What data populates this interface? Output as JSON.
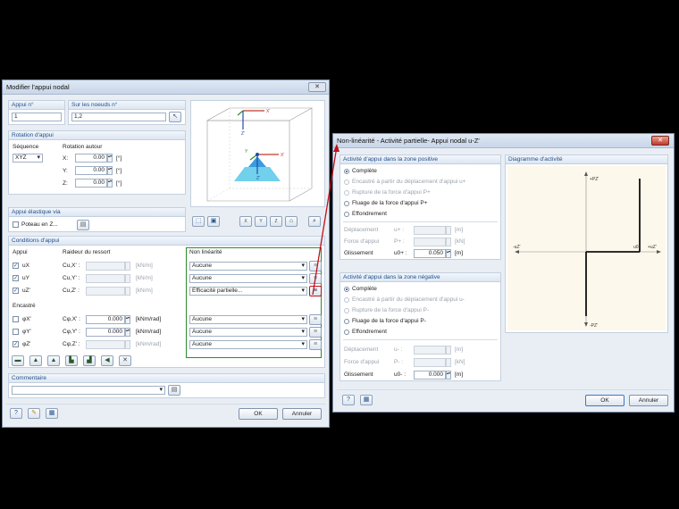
{
  "dialog1": {
    "title": "Modifier l'appui nodal",
    "appui_no_label": "Appui n°",
    "appui_no": "1",
    "noeuds_label": "Sur les noeuds n°",
    "noeuds": "1,2",
    "rotation_header": "Rotation d'appui",
    "sequence_label": "Séquence",
    "sequence_value": "XYZ",
    "rotation_label": "Rotation autour",
    "rot": [
      {
        "axis": "X:",
        "value": "0.00",
        "unit": "[°]"
      },
      {
        "axis": "Y:",
        "value": "0.00",
        "unit": "[°]"
      },
      {
        "axis": "Z:",
        "value": "0.00",
        "unit": "[°]"
      }
    ],
    "elastic_header": "Appui élastique via",
    "poteau_label": "Poteau en Z...",
    "conditions_header": "Conditions d'appui",
    "appui_col": "Appui",
    "raideur_col": "Raideur du ressort",
    "nonlin_col": "Non linéarité",
    "trans_rows": [
      {
        "name": "uX",
        "checked": true,
        "coef": "Cu,X' :",
        "unit": "[kN/m]",
        "nonlin": "Aucune"
      },
      {
        "name": "uY",
        "checked": true,
        "coef": "Cu,Y' :",
        "unit": "[kN/m]",
        "nonlin": "Aucune"
      },
      {
        "name": "uZ'",
        "checked": true,
        "coef": "Cu,Z' :",
        "unit": "[kN/m]",
        "nonlin": "Efficacité partielle..."
      }
    ],
    "encastre_label": "Encastré",
    "rot_rows": [
      {
        "name": "φX'",
        "checked": false,
        "coef": "Cφ,X' :",
        "value": "0.000",
        "unit": "[kNm/rad]",
        "nonlin": "Aucune"
      },
      {
        "name": "φY'",
        "checked": false,
        "coef": "Cφ,Y' :",
        "value": "0.000",
        "unit": "[kNm/rad]",
        "nonlin": "Aucune"
      },
      {
        "name": "φZ'",
        "checked": true,
        "coef": "Cφ,Z' :",
        "value": "",
        "unit": "[kNm/rad]",
        "nonlin": "Aucune"
      }
    ],
    "commentaire_header": "Commentaire",
    "ok": "OK",
    "annuler": "Annuler",
    "axis_x": "X'",
    "axis_y": "Y",
    "axis_z": "Z'"
  },
  "dialog2": {
    "title": "Non-linéarité - Activité partielle- Appui nodal u-Z'",
    "pos_header": "Activité d'appui dans la zone positive",
    "pos_options": [
      {
        "label": "Complète",
        "selected": true,
        "enabled": true
      },
      {
        "label": "Encastré à partir du déplacement d'appui u+",
        "selected": false,
        "enabled": false
      },
      {
        "label": "Rupture de la force d'appui P+",
        "selected": false,
        "enabled": false
      },
      {
        "label": "Fluage de la force d'appui P+",
        "selected": false,
        "enabled": true
      },
      {
        "label": "Effondrement",
        "selected": false,
        "enabled": true
      }
    ],
    "pos_fields": [
      {
        "label": "Déplacement",
        "sym": "u+ :",
        "value": "",
        "unit": "[m]",
        "enabled": false
      },
      {
        "label": "Force d'appui",
        "sym": "P+ :",
        "value": "",
        "unit": "[kN]",
        "enabled": false
      },
      {
        "label": "Glissement",
        "sym": "u0+ :",
        "value": "0.050",
        "unit": "[m]",
        "enabled": true
      }
    ],
    "neg_header": "Activité d'appui dans la zone négative",
    "neg_options": [
      {
        "label": "Complète",
        "selected": true,
        "enabled": true
      },
      {
        "label": "Encastré à partir du déplacement d'appui u-",
        "selected": false,
        "enabled": false
      },
      {
        "label": "Rupture de la force d'appui P-",
        "selected": false,
        "enabled": false
      },
      {
        "label": "Fluage de la force d'appui P-",
        "selected": false,
        "enabled": true
      },
      {
        "label": "Effondrement",
        "selected": false,
        "enabled": true
      }
    ],
    "neg_fields": [
      {
        "label": "Déplacement",
        "sym": "u- :",
        "value": "",
        "unit": "[m]",
        "enabled": false
      },
      {
        "label": "Force d'appui",
        "sym": "P- :",
        "value": "",
        "unit": "[kN]",
        "enabled": false
      },
      {
        "label": "Glissement",
        "sym": "u0- :",
        "value": "0.000",
        "unit": "[m]",
        "enabled": true
      }
    ],
    "diagram_header": "Diagramme d'activité",
    "diag_top": "+PZ'",
    "diag_bottom": "-PZ'",
    "diag_left": "-uZ'",
    "diag_u0": "u0+",
    "diag_right": "+uZ'",
    "ok": "OK",
    "annuler": "Annuler"
  },
  "colors": {
    "accent": "#1f4f8a",
    "highlight_green": "#2e8b2e",
    "arrow_red": "#c0101a",
    "close_red": "#c0392b"
  }
}
